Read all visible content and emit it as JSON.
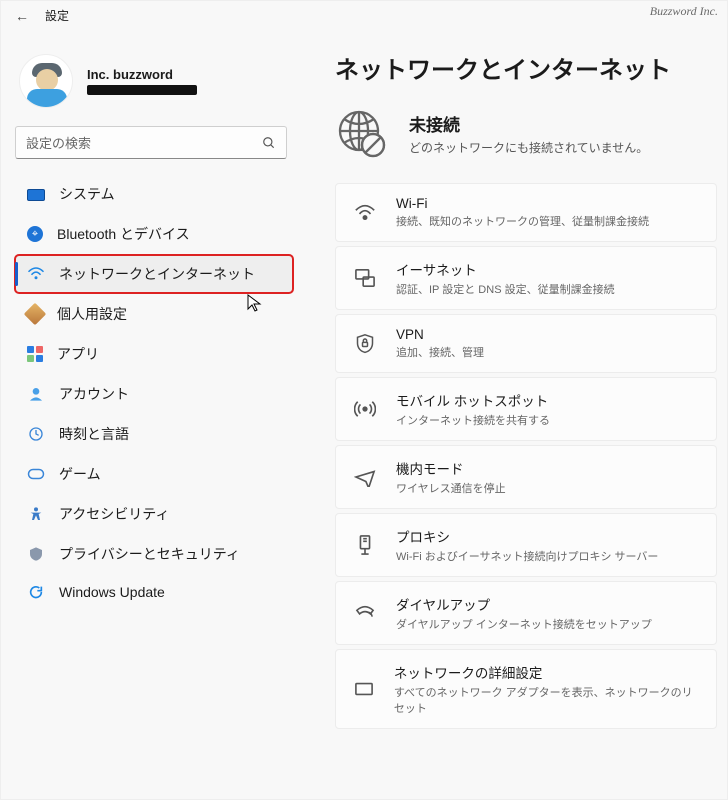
{
  "brand": "Buzzword Inc.",
  "app_title": "設定",
  "user": {
    "name": "Inc. buzzword"
  },
  "search": {
    "placeholder": "設定の検索"
  },
  "sidebar": {
    "items": [
      {
        "label": "システム",
        "icon": "system"
      },
      {
        "label": "Bluetooth とデバイス",
        "icon": "bluetooth"
      },
      {
        "label": "ネットワークとインターネット",
        "icon": "wifi",
        "selected": true,
        "highlight": true
      },
      {
        "label": "個人用設定",
        "icon": "personalization"
      },
      {
        "label": "アプリ",
        "icon": "apps"
      },
      {
        "label": "アカウント",
        "icon": "account"
      },
      {
        "label": "時刻と言語",
        "icon": "time-language"
      },
      {
        "label": "ゲーム",
        "icon": "gaming"
      },
      {
        "label": "アクセシビリティ",
        "icon": "accessibility"
      },
      {
        "label": "プライバシーとセキュリティ",
        "icon": "privacy"
      },
      {
        "label": "Windows Update",
        "icon": "windows-update"
      }
    ]
  },
  "page": {
    "heading": "ネットワークとインターネット",
    "status_title": "未接続",
    "status_sub": "どのネットワークにも接続されていません。",
    "cards": [
      {
        "title": "Wi-Fi",
        "sub": "接続、既知のネットワークの管理、従量制課金接続",
        "icon": "wifi"
      },
      {
        "title": "イーサネット",
        "sub": "認証、IP 設定と DNS 設定、従量制課金接続",
        "icon": "ethernet"
      },
      {
        "title": "VPN",
        "sub": "追加、接続、管理",
        "icon": "vpn"
      },
      {
        "title": "モバイル ホットスポット",
        "sub": "インターネット接続を共有する",
        "icon": "hotspot"
      },
      {
        "title": "機内モード",
        "sub": "ワイヤレス通信を停止",
        "icon": "airplane"
      },
      {
        "title": "プロキシ",
        "sub": "Wi-Fi およびイーサネット接続向けプロキシ サーバー",
        "icon": "proxy"
      },
      {
        "title": "ダイヤルアップ",
        "sub": "ダイヤルアップ インターネット接続をセットアップ",
        "icon": "dialup"
      },
      {
        "title": "ネットワークの詳細設定",
        "sub": "すべてのネットワーク アダプターを表示、ネットワークのリセット",
        "icon": "advanced"
      }
    ]
  }
}
